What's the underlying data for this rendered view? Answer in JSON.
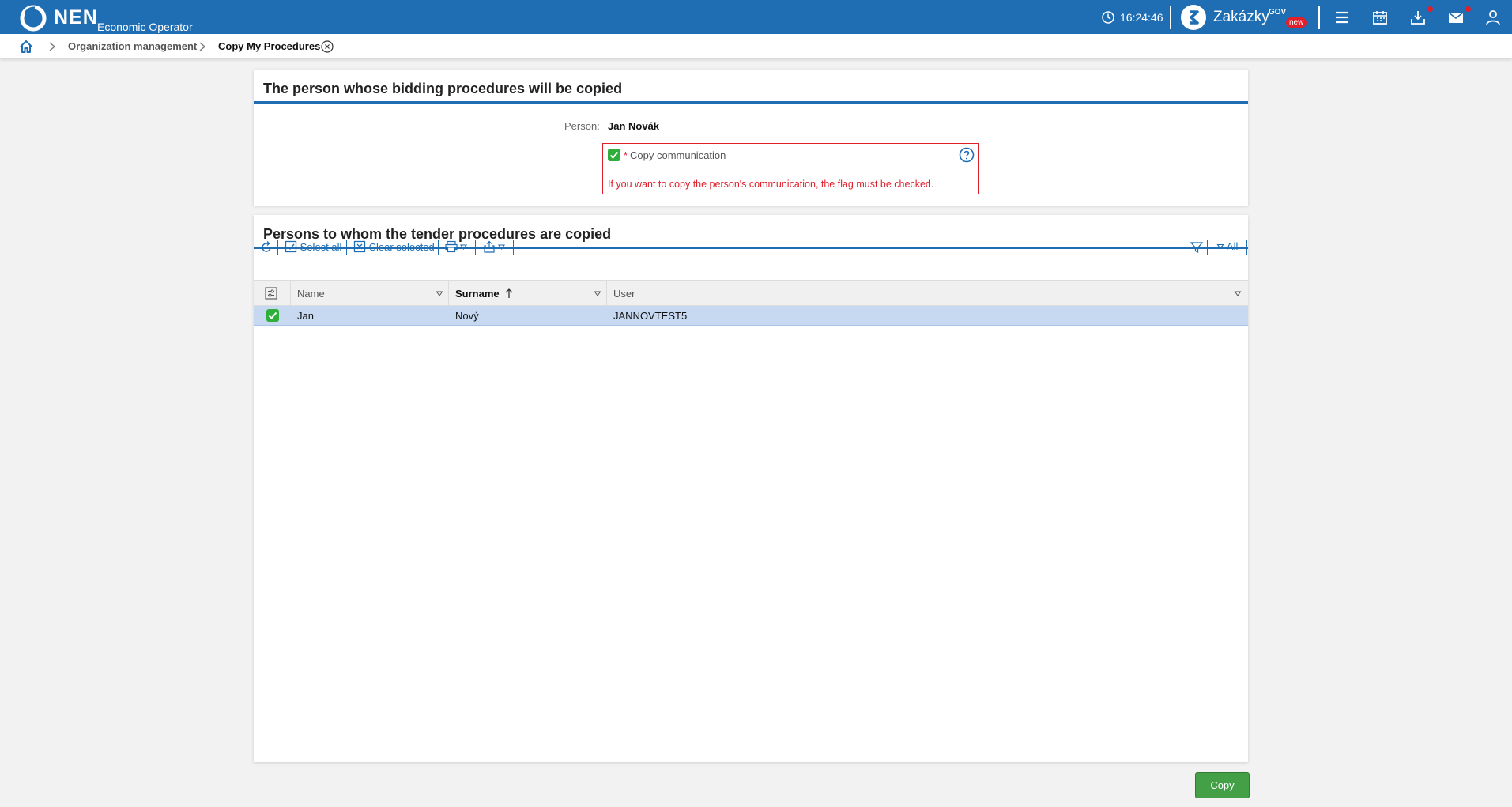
{
  "app": {
    "brand": "NEN",
    "subtitle": "Economic Operator",
    "time": "16:24:46",
    "zakazky": {
      "name": "Zakázky",
      "sup": "GOV",
      "badge": "new"
    }
  },
  "breadcrumb": {
    "items": [
      "Organization management",
      "Copy My Procedures"
    ]
  },
  "source_panel": {
    "title": "The person whose bidding procedures will be copied",
    "person_label": "Person:",
    "person_value": "Jan Novák",
    "checkbox_required": "*",
    "checkbox_label": "Copy communication",
    "checkbox_checked": true,
    "error_text": "If you want to copy the person's communication, the flag must be checked."
  },
  "target_panel": {
    "title": "Persons to whom the tender procedures are copied",
    "toolbar": {
      "select_all": "Select all",
      "clear_selected": "Clear selected",
      "filter_all": "All"
    },
    "columns": [
      "Name",
      "Surname",
      "User"
    ],
    "sorted_column": "Surname",
    "rows": [
      {
        "checked": true,
        "name": "Jan",
        "surname": "Nový",
        "user": "JANNOVTEST5"
      }
    ]
  },
  "actions": {
    "copy": "Copy"
  },
  "colors": {
    "header": "#1f6eb4",
    "error": "#e01f2b",
    "success": "#43a047",
    "selected_row": "#c6d9f1"
  }
}
